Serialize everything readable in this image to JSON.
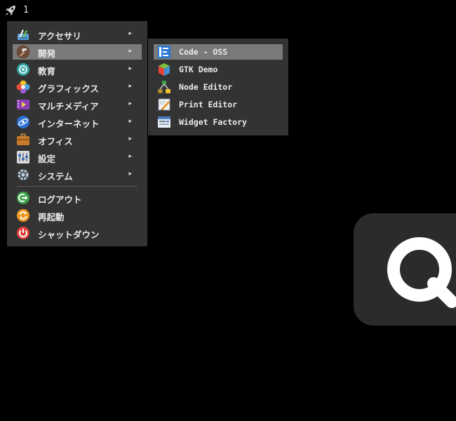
{
  "topbar": {
    "launcher_icon": "rocket-icon",
    "workspace": "1"
  },
  "menu": {
    "items": [
      {
        "label": "アクセサリ",
        "icon": "accessories-icon",
        "submenu": true
      },
      {
        "label": "開発",
        "icon": "development-icon",
        "submenu": true,
        "active": true
      },
      {
        "label": "教育",
        "icon": "education-icon",
        "submenu": true
      },
      {
        "label": "グラフィックス",
        "icon": "graphics-icon",
        "submenu": true
      },
      {
        "label": "マルチメディア",
        "icon": "multimedia-icon",
        "submenu": true
      },
      {
        "label": "インターネット",
        "icon": "internet-icon",
        "submenu": true
      },
      {
        "label": "オフィス",
        "icon": "office-icon",
        "submenu": true
      },
      {
        "label": "設定",
        "icon": "settings-icon",
        "submenu": true
      },
      {
        "label": "システム",
        "icon": "system-icon",
        "submenu": true
      }
    ],
    "actions": [
      {
        "label": "ログアウト",
        "icon": "logout-icon"
      },
      {
        "label": "再起動",
        "icon": "reboot-icon"
      },
      {
        "label": "シャットダウン",
        "icon": "shutdown-icon"
      }
    ],
    "arrow": "▸"
  },
  "submenu": {
    "items": [
      {
        "label": "Code - OSS",
        "icon": "code-oss-icon",
        "active": true
      },
      {
        "label": "GTK Demo",
        "icon": "gtk-demo-icon"
      },
      {
        "label": "Node Editor",
        "icon": "node-editor-icon"
      },
      {
        "label": "Print Editor",
        "icon": "print-editor-icon"
      },
      {
        "label": "Widget Factory",
        "icon": "widget-factory-icon"
      }
    ]
  },
  "colors": {
    "menu_bg": "#333333",
    "highlight": "#7a7a7a",
    "background": "#000000",
    "dock_bg": "#2b2b2b"
  }
}
